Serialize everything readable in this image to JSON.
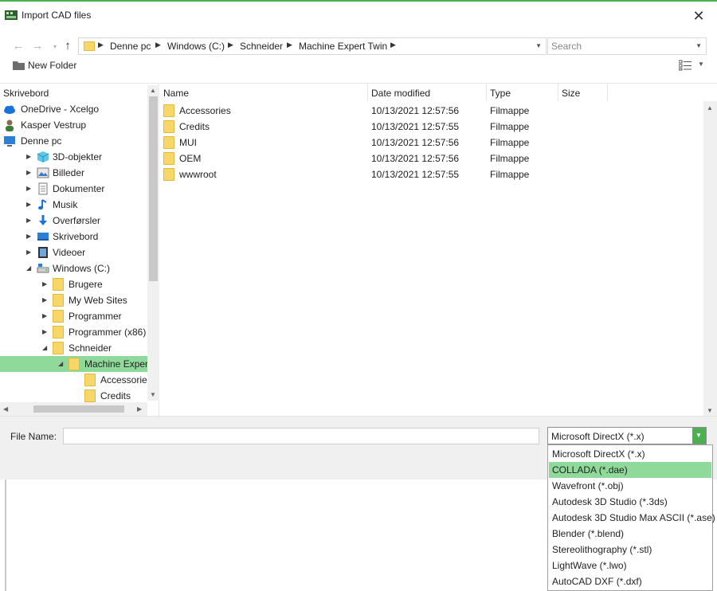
{
  "window": {
    "title": "Import CAD files",
    "accent": "#4caf50"
  },
  "nav": {
    "breadcrumbs": [
      "Denne pc",
      "Windows (C:)",
      "Schneider",
      "Machine Expert Twin"
    ],
    "search_placeholder": "Search"
  },
  "toolbar": {
    "new_folder": "New Folder"
  },
  "tree": [
    {
      "label": "Skrivebord",
      "icon": "none",
      "arrow": ""
    },
    {
      "label": "OneDrive - Xcelgo",
      "icon": "cloud-icon",
      "arrow": ""
    },
    {
      "label": "Kasper Vestrup",
      "icon": "user-icon",
      "arrow": ""
    },
    {
      "label": "Denne pc",
      "icon": "computer-icon",
      "arrow": ""
    },
    {
      "label": "3D-objekter",
      "icon": "cube-icon",
      "arrow": "collapsed"
    },
    {
      "label": "Billeder",
      "icon": "pictures-icon",
      "arrow": "collapsed"
    },
    {
      "label": "Dokumenter",
      "icon": "documents-icon",
      "arrow": "collapsed"
    },
    {
      "label": "Musik",
      "icon": "music-icon",
      "arrow": "collapsed"
    },
    {
      "label": "Overførsler",
      "icon": "download-icon",
      "arrow": "collapsed"
    },
    {
      "label": "Skrivebord",
      "icon": "desktop-icon",
      "arrow": "collapsed"
    },
    {
      "label": "Videoer",
      "icon": "video-icon",
      "arrow": "collapsed"
    },
    {
      "label": "Windows (C:)",
      "icon": "drive-icon",
      "arrow": "expanded"
    },
    {
      "label": "Brugere",
      "icon": "folder-icon",
      "arrow": "collapsed"
    },
    {
      "label": "My Web Sites",
      "icon": "folder-icon",
      "arrow": "collapsed"
    },
    {
      "label": "Programmer",
      "icon": "folder-icon",
      "arrow": "collapsed"
    },
    {
      "label": "Programmer (x86)",
      "icon": "folder-icon",
      "arrow": "collapsed"
    },
    {
      "label": "Schneider",
      "icon": "folder-icon",
      "arrow": "expanded"
    },
    {
      "label": "Machine Expert Twin",
      "icon": "folder-icon",
      "arrow": "expanded",
      "selected": true
    },
    {
      "label": "Accessories",
      "icon": "folder-icon",
      "arrow": ""
    },
    {
      "label": "Credits",
      "icon": "folder-icon",
      "arrow": ""
    }
  ],
  "columns": [
    "Name",
    "Date modified",
    "Type",
    "Size"
  ],
  "files": [
    {
      "name": "Accessories",
      "date": "10/13/2021 12:57:56",
      "type": "Filmappe",
      "size": ""
    },
    {
      "name": "Credits",
      "date": "10/13/2021 12:57:55",
      "type": "Filmappe",
      "size": ""
    },
    {
      "name": "MUI",
      "date": "10/13/2021 12:57:56",
      "type": "Filmappe",
      "size": ""
    },
    {
      "name": "OEM",
      "date": "10/13/2021 12:57:56",
      "type": "Filmappe",
      "size": ""
    },
    {
      "name": "wwwroot",
      "date": "10/13/2021 12:57:55",
      "type": "Filmappe",
      "size": ""
    }
  ],
  "bottom": {
    "file_name_label": "File Name:",
    "file_name_value": "",
    "file_type_selected": "Microsoft DirectX (*.x)"
  },
  "file_types": [
    "Microsoft DirectX (*.x)",
    "COLLADA (*.dae)",
    "Wavefront (*.obj)",
    "Autodesk 3D Studio (*.3ds)",
    "Autodesk 3D Studio Max ASCII (*.ase)",
    "Blender (*.blend)",
    "Stereolithography (*.stl)",
    "LightWave (*.lwo)",
    "AutoCAD DXF (*.dxf)"
  ],
  "file_types_highlighted": 1
}
